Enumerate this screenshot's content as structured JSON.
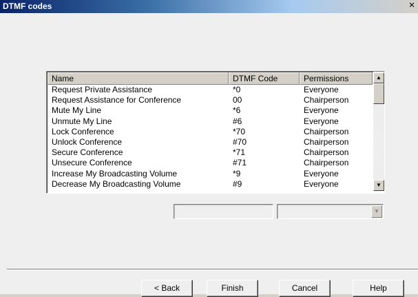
{
  "window": {
    "title": "DTMF codes",
    "close_glyph": "×"
  },
  "list": {
    "columns": {
      "name": "Name",
      "code": "DTMF Code",
      "permissions": "Permissions"
    },
    "rows": [
      {
        "name": "Request Private Assistance",
        "code": "*0",
        "permissions": "Everyone"
      },
      {
        "name": "Request Assistance for Conference",
        "code": "00",
        "permissions": "Chairperson"
      },
      {
        "name": "Mute My Line",
        "code": "*6",
        "permissions": "Everyone"
      },
      {
        "name": "Unmute My Line",
        "code": "#6",
        "permissions": "Everyone"
      },
      {
        "name": "Lock Conference",
        "code": "*70",
        "permissions": "Chairperson"
      },
      {
        "name": "Unlock Conference",
        "code": "#70",
        "permissions": "Chairperson"
      },
      {
        "name": "Secure Conference",
        "code": "*71",
        "permissions": "Chairperson"
      },
      {
        "name": "Unsecure Conference",
        "code": "#71",
        "permissions": "Chairperson"
      },
      {
        "name": "Increase My Broadcasting Volume",
        "code": "*9",
        "permissions": "Everyone"
      },
      {
        "name": "Decrease My Broadcasting Volume",
        "code": "#9",
        "permissions": "Everyone"
      }
    ],
    "scroll_up_glyph": "▲",
    "scroll_down_glyph": "▼"
  },
  "editor": {
    "code_value": "",
    "permission_value": "",
    "dropdown_glyph": "▼"
  },
  "buttons": {
    "back": "< Back",
    "finish": "Finish",
    "cancel": "Cancel",
    "help": "Help"
  }
}
